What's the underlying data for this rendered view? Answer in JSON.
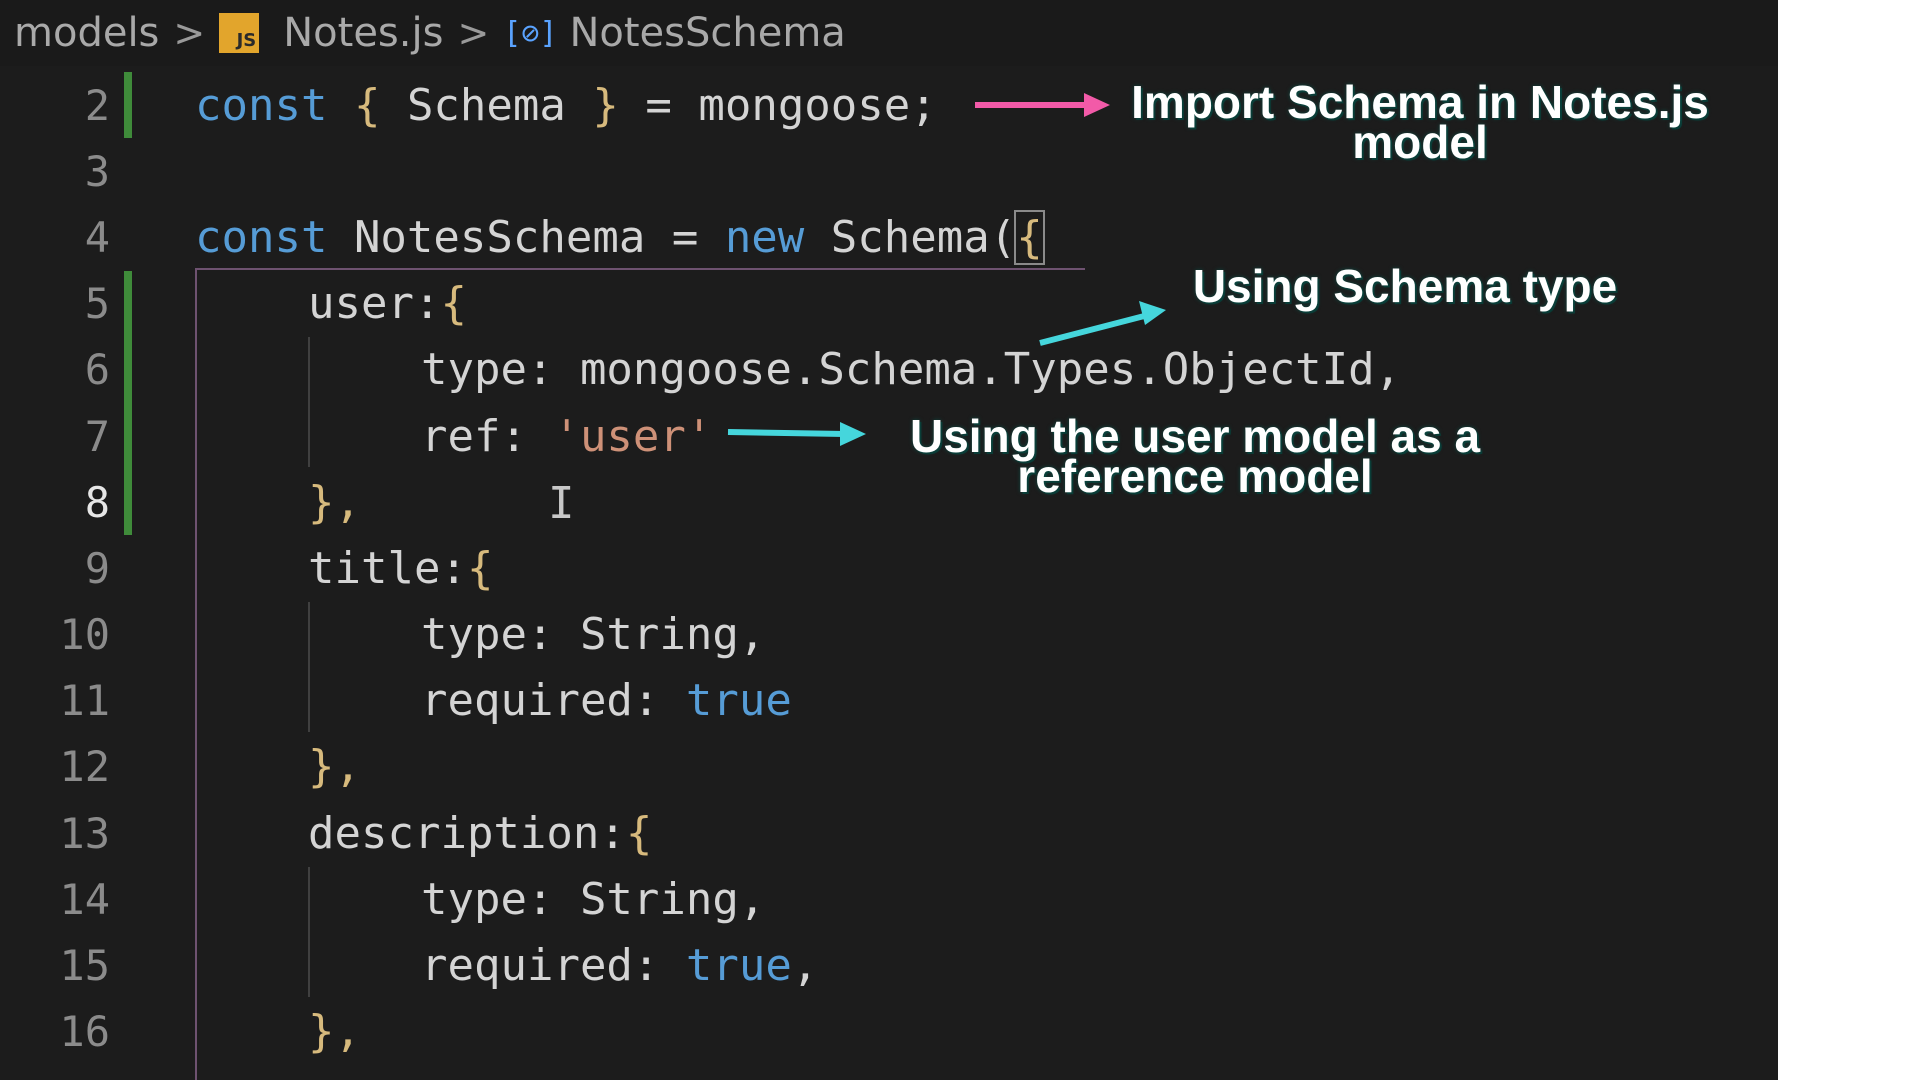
{
  "breadcrumb": {
    "folder": "models",
    "file": "Notes.js",
    "file_icon": "JS",
    "symbol_icon": "[⊘]",
    "symbol": "NotesSchema",
    "separator": ">"
  },
  "code_lines": [
    {
      "num": "2",
      "active": false,
      "changed": true
    },
    {
      "num": "3",
      "active": false,
      "changed": false
    },
    {
      "num": "4",
      "active": false,
      "changed": false
    },
    {
      "num": "5",
      "active": false,
      "changed": true
    },
    {
      "num": "6",
      "active": false,
      "changed": true
    },
    {
      "num": "7",
      "active": false,
      "changed": true
    },
    {
      "num": "8",
      "active": true,
      "changed": true
    },
    {
      "num": "9",
      "active": false,
      "changed": false
    },
    {
      "num": "10",
      "active": false,
      "changed": false
    },
    {
      "num": "11",
      "active": false,
      "changed": false
    },
    {
      "num": "12",
      "active": false,
      "changed": false
    },
    {
      "num": "13",
      "active": false,
      "changed": false
    },
    {
      "num": "14",
      "active": false,
      "changed": false
    },
    {
      "num": "15",
      "active": false,
      "changed": false
    },
    {
      "num": "16",
      "active": false,
      "changed": false
    }
  ],
  "code": {
    "l2": {
      "kw": "const",
      "open": "{",
      "name": " Schema ",
      "close": "}",
      "rest": " = mongoose;"
    },
    "l4": {
      "kw": "const",
      "name": " NotesSchema = ",
      "kw2": "new",
      "call": " Schema(",
      "brace": "{"
    },
    "l5": {
      "key": "user:",
      "brace": "{"
    },
    "l6": {
      "text": "type: mongoose.Schema.Types.ObjectId,"
    },
    "l7": {
      "key": "ref: ",
      "str": "'user'"
    },
    "l8": {
      "text": "},"
    },
    "l9": {
      "key": "title:",
      "brace": "{"
    },
    "l10": {
      "text": "type: String,"
    },
    "l11": {
      "key": "required: ",
      "val": "true"
    },
    "l12": {
      "text": "},"
    },
    "l13": {
      "key": "description:",
      "brace": "{"
    },
    "l14": {
      "text": "type: String,"
    },
    "l15": {
      "key": "required: ",
      "val": "true",
      "tail": ","
    },
    "l16": {
      "text": "},"
    }
  },
  "annotations": {
    "import": {
      "line1": "Import Schema in Notes.js",
      "line2": "model",
      "arrow_color": "#f25aa8"
    },
    "schema_type": {
      "text": "Using Schema type",
      "arrow_color": "#45d6dc"
    },
    "reference": {
      "line1": "Using the user model as a",
      "line2": "reference model",
      "arrow_color": "#45d6dc"
    }
  },
  "colors": {
    "editor_bg": "#1c1c1c",
    "keyword": "#569cd6",
    "string": "#ce9178",
    "bracket": "#d7ba7d",
    "gutter_changed": "#3f8b3a"
  }
}
